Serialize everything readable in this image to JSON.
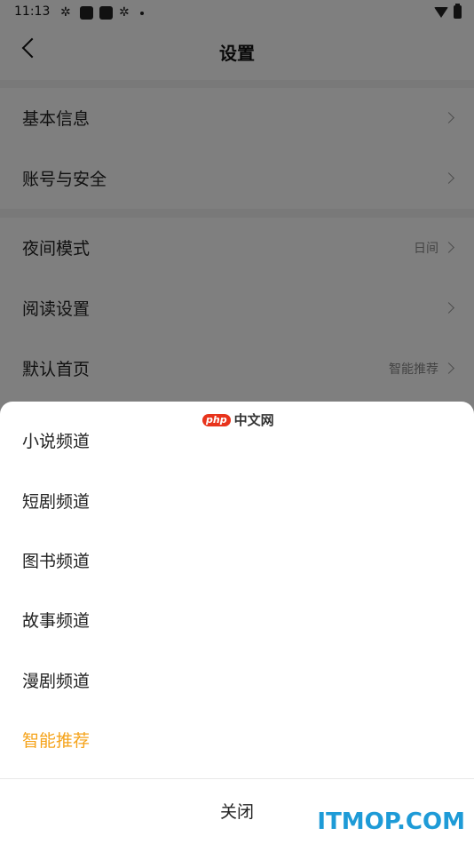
{
  "status_bar": {
    "time": "11:13"
  },
  "header": {
    "title": "设置"
  },
  "settings": {
    "group1": [
      {
        "label": "基本信息",
        "value": ""
      },
      {
        "label": "账号与安全",
        "value": ""
      }
    ],
    "group2": [
      {
        "label": "夜间模式",
        "value": "日间"
      },
      {
        "label": "阅读设置",
        "value": ""
      },
      {
        "label": "默认首页",
        "value": "智能推荐"
      }
    ]
  },
  "sheet": {
    "options": [
      {
        "label": "小说频道",
        "selected": false
      },
      {
        "label": "短剧频道",
        "selected": false
      },
      {
        "label": "图书频道",
        "selected": false
      },
      {
        "label": "故事频道",
        "selected": false
      },
      {
        "label": "漫剧频道",
        "selected": false
      },
      {
        "label": "智能推荐",
        "selected": true
      }
    ],
    "close_label": "关闭"
  },
  "watermarks": {
    "php_badge": "php",
    "php_text": "中文网",
    "itmop": "ITMOP.COM"
  },
  "colors": {
    "accent": "#f5a31a",
    "overlay": "rgba(0,0,0,0.5)"
  }
}
